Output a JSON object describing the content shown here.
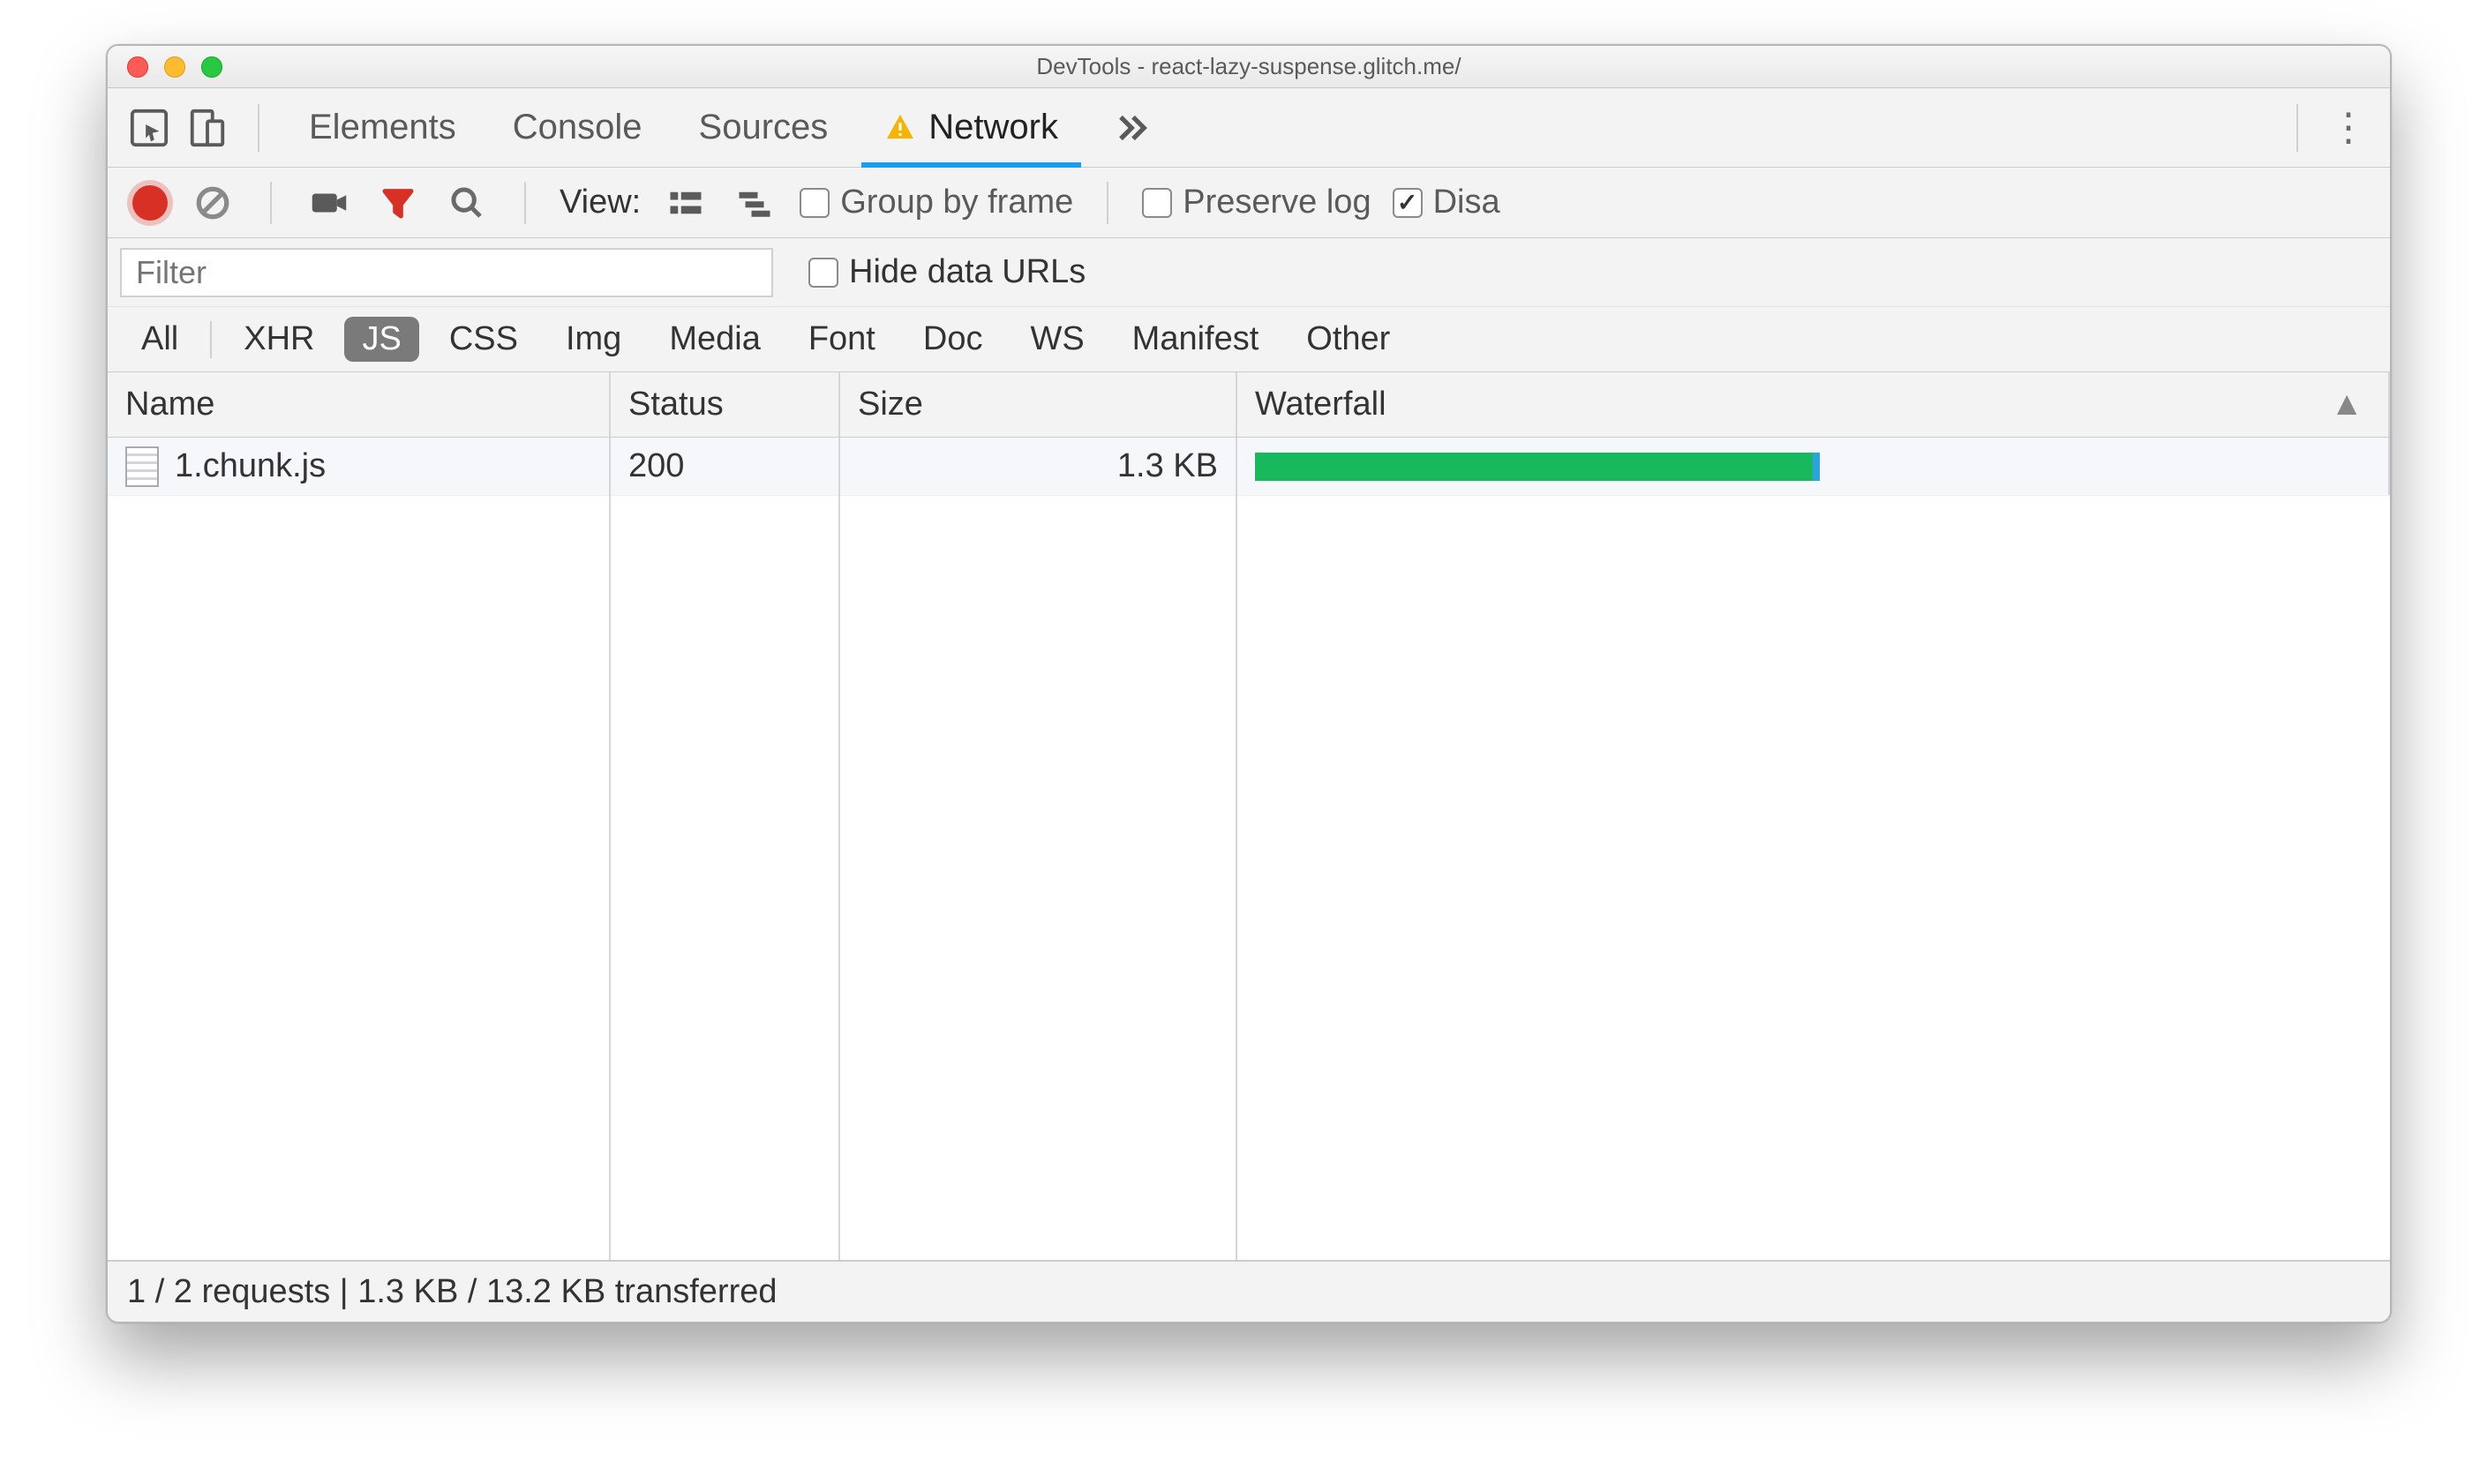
{
  "window": {
    "title": "DevTools - react-lazy-suspense.glitch.me/"
  },
  "tabs": {
    "items": [
      "Elements",
      "Console",
      "Sources",
      "Network"
    ],
    "active_index": 3,
    "has_warning_on_active": true
  },
  "toolbar": {
    "view_label": "View:",
    "group_by_frame": {
      "label": "Group by frame",
      "checked": false
    },
    "preserve_log": {
      "label": "Preserve log",
      "checked": false
    },
    "disable_cache": {
      "label_visible": "Disa",
      "checked": true
    }
  },
  "filter": {
    "placeholder": "Filter",
    "hide_data_urls": {
      "label": "Hide data URLs",
      "checked": false
    }
  },
  "type_filters": {
    "items": [
      "All",
      "XHR",
      "JS",
      "CSS",
      "Img",
      "Media",
      "Font",
      "Doc",
      "WS",
      "Manifest",
      "Other"
    ],
    "selected_index": 2
  },
  "table": {
    "columns": [
      "Name",
      "Status",
      "Size",
      "Waterfall"
    ],
    "rows": [
      {
        "name": "1.chunk.js",
        "status": "200",
        "size": "1.3 KB",
        "waterfall_pct": 50
      }
    ]
  },
  "statusbar": {
    "text": "1 / 2 requests | 1.3 KB / 13.2 KB transferred"
  }
}
